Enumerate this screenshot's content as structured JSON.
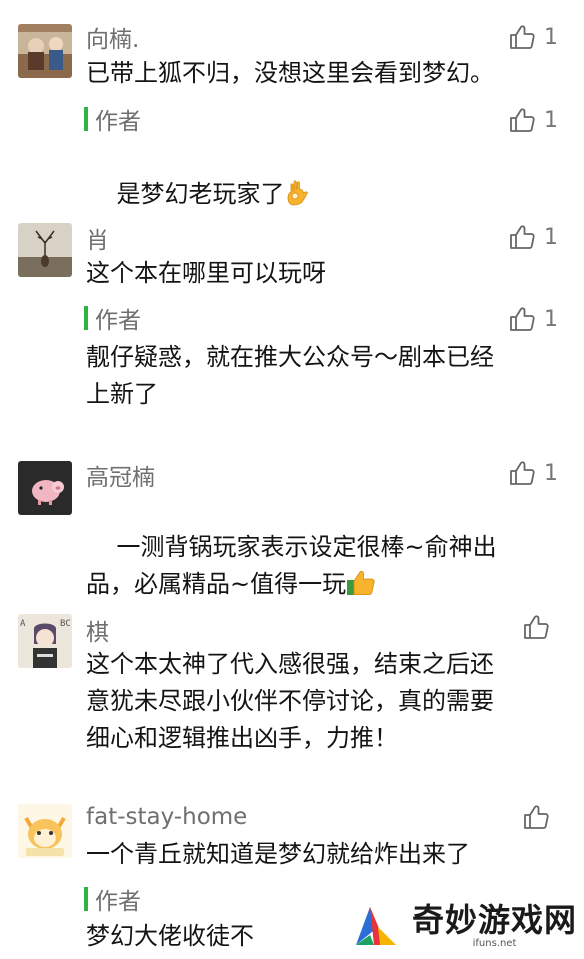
{
  "comments": [
    {
      "user": "向楠.",
      "text": "已带上狐不归，没想这里会看到梦幻。",
      "likes": "1",
      "reply": {
        "label": "作者",
        "text": "是梦幻老玩家了",
        "emoji": "ok-hand-icon",
        "likes": "1"
      }
    },
    {
      "user": "肖",
      "text": "这个本在哪里可以玩呀",
      "likes": "1",
      "reply": {
        "label": "作者",
        "text": "靓仔疑惑，就在推大公众号～剧本已经\n上新了",
        "likes": "1"
      }
    },
    {
      "user": "高冠楠",
      "text": "一测背锅玩家表示设定很棒~俞神出\n品，必属精品~值得一玩",
      "emoji": "thumbs-up-icon",
      "likes": "1"
    },
    {
      "user": "棋",
      "text": "这个本太神了代入感很强，结束之后还\n意犹未尽跟小伙伴不停讨论，真的需要\n细心和逻辑推出凶手，力推！",
      "likes": ""
    },
    {
      "user": "fat-stay-home",
      "text": "一个青丘就知道是梦幻就给炸出来了",
      "likes": "",
      "reply": {
        "label": "作者",
        "text": "梦幻大佬收徒不"
      }
    }
  ],
  "watermark": {
    "title": "奇妙游戏网",
    "url": "ifuns.net"
  },
  "colors": {
    "accent_green": "#2fb344",
    "meta_gray": "#6f6f6f"
  }
}
